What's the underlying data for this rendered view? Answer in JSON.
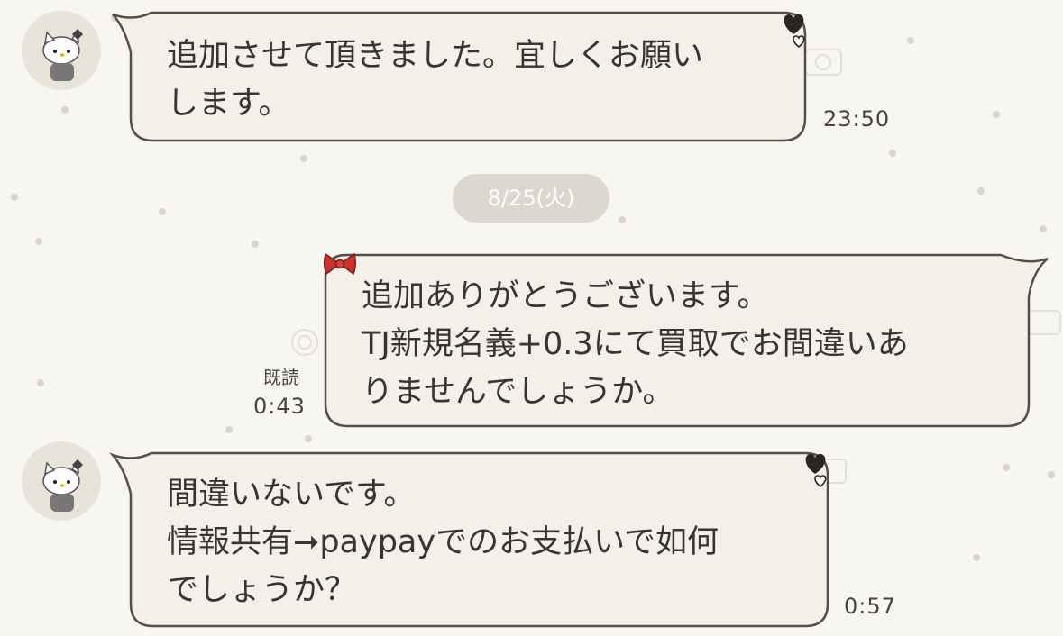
{
  "messages": [
    {
      "side": "incoming",
      "lines": [
        "追加させて頂きました。宜しくお願い",
        "します。"
      ],
      "time": "23:50"
    },
    {
      "side": "outgoing",
      "lines": [
        "追加ありがとうございます。",
        "TJ新規名義+0.3にて買取でお間違いあ",
        "りませんでしょうか。"
      ],
      "read_label": "既読",
      "time": "0:43"
    },
    {
      "side": "incoming",
      "lines": [
        "間違いないです。",
        "情報共有➞paypayでのお支払いで如何",
        "でしょうか？"
      ],
      "time": "0:57"
    }
  ],
  "date_separator": "8/25(火)",
  "theme": {
    "icon_avatar": "hello-kitty-avatar",
    "icon_incoming": "black-heart-icon",
    "icon_outgoing": "red-bow-icon",
    "bubble_fill": "#f3f0ea",
    "bubble_stroke": "#5a4d48"
  }
}
